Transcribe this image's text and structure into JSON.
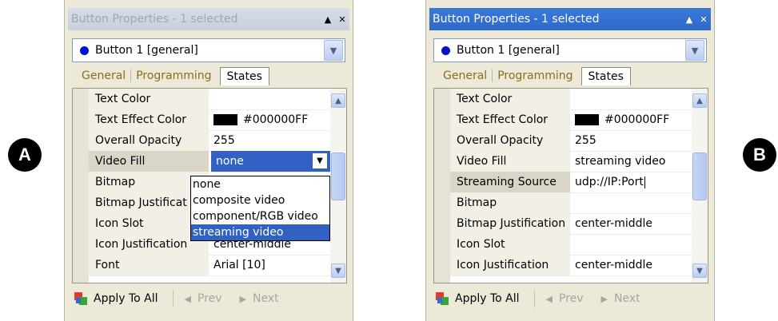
{
  "badges": {
    "a": "A",
    "b": "B"
  },
  "panel_a": {
    "title": "Button Properties - 1 selected",
    "combo_label": "Button 1  [general]",
    "tabs": [
      "General",
      "Programming",
      "States"
    ],
    "rows": [
      {
        "label": "Text Color",
        "value": ""
      },
      {
        "label": "Text Effect Color",
        "value": "#000000FF"
      },
      {
        "label": "Overall Opacity",
        "value": "255"
      },
      {
        "label": "Video Fill",
        "value": "none"
      },
      {
        "label": "Bitmap",
        "value": ""
      },
      {
        "label": "Bitmap Justificat",
        "value": ""
      },
      {
        "label": "Icon Slot",
        "value": ""
      },
      {
        "label": "Icon Justification",
        "value": "center-middle"
      },
      {
        "label": "Font",
        "value": "Arial [10]"
      }
    ],
    "dropdown_options": [
      "none",
      "composite video",
      "component/RGB video",
      "streaming video"
    ],
    "footer": {
      "apply": "Apply To All",
      "prev": "Prev",
      "next": "Next"
    }
  },
  "panel_b": {
    "title": "Button Properties - 1 selected",
    "combo_label": "Button 1  [general]",
    "tabs": [
      "General",
      "Programming",
      "States"
    ],
    "rows": [
      {
        "label": "Text Color",
        "value": ""
      },
      {
        "label": "Text Effect Color",
        "value": "#000000FF"
      },
      {
        "label": "Overall Opacity",
        "value": "255"
      },
      {
        "label": "Video Fill",
        "value": "streaming video"
      },
      {
        "label": "Streaming Source",
        "value": "udp://IP:Port"
      },
      {
        "label": "Bitmap",
        "value": ""
      },
      {
        "label": "Bitmap Justification",
        "value": "center-middle"
      },
      {
        "label": "Icon Slot",
        "value": ""
      },
      {
        "label": "Icon Justification",
        "value": "center-middle"
      }
    ],
    "footer": {
      "apply": "Apply To All",
      "prev": "Prev",
      "next": "Next"
    }
  },
  "icons": {
    "minimize": "▲",
    "close": "✕",
    "dropdown": "▼",
    "scroll_up": "▲",
    "scroll_down": "▼",
    "prev": "◀",
    "next": "▶"
  },
  "colors": {
    "selection": "#3161c5",
    "title_active": "#2f6ac8",
    "bullet": "#0010d0"
  }
}
